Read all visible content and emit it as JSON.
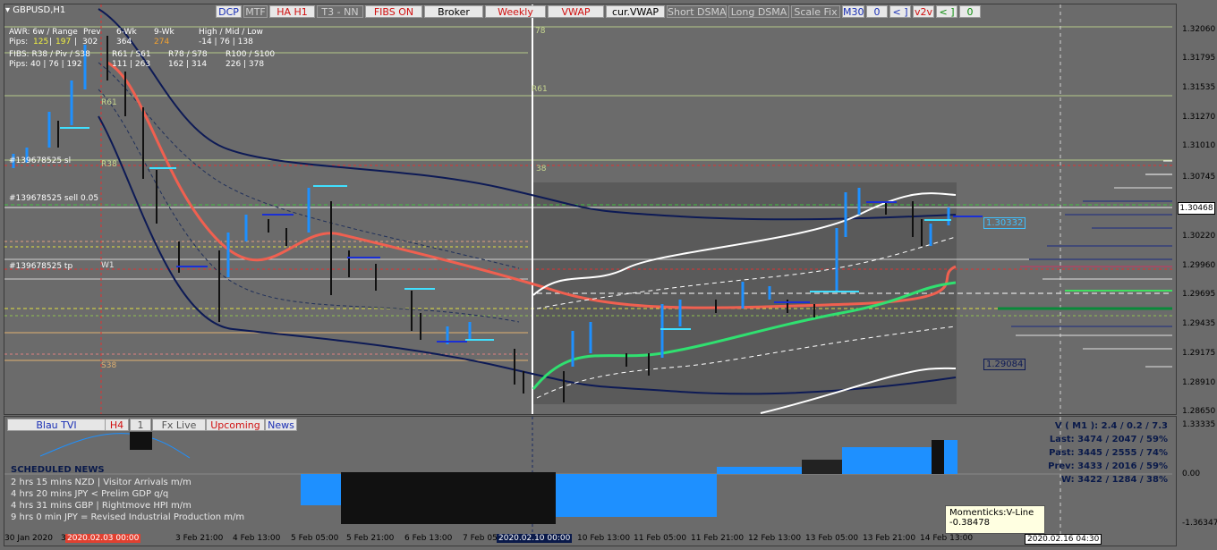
{
  "symbol_title": "GBPUSD,H1",
  "toolbar": [
    {
      "label": "DCP",
      "color": "#1a2fb5",
      "bg": "light"
    },
    {
      "label": "MTF",
      "color": "#d0d0d0",
      "bg": "dark"
    },
    {
      "label": "HA H1",
      "color": "#d01010",
      "bg": "light"
    },
    {
      "label": "T3 - NN",
      "color": "#d0d0d0",
      "bg": "dark"
    },
    {
      "label": "FIBS ON",
      "color": "#d01010",
      "bg": "light"
    },
    {
      "label": "Broker",
      "color": "#000000",
      "bg": "light"
    },
    {
      "label": "Weekly",
      "color": "#d01010",
      "bg": "light"
    },
    {
      "label": "VWAP",
      "color": "#d01010",
      "bg": "light"
    },
    {
      "label": "cur.VWAP",
      "color": "#000000",
      "bg": "light"
    },
    {
      "label": "Short DSMA",
      "color": "#d0d0d0",
      "bg": "dark"
    },
    {
      "label": "Long DSMA",
      "color": "#d0d0d0",
      "bg": "dark"
    },
    {
      "label": "Scale Fix",
      "color": "#d0d0d0",
      "bg": "dark"
    },
    {
      "label": "M30",
      "color": "#1a2fb5",
      "bg": "light"
    },
    {
      "label": "0",
      "color": "#1a2fb5",
      "bg": "light"
    },
    {
      "label": "< ]",
      "color": "#1a2fb5",
      "bg": "light"
    },
    {
      "label": "v2v",
      "color": "#d01010",
      "bg": "light"
    },
    {
      "label": "< ]",
      "color": "#0a8a0a",
      "bg": "light"
    },
    {
      "label": "0",
      "color": "#0a8a0a",
      "bg": "light"
    }
  ],
  "info_panel": {
    "awr_label": "AWR: 6w / Range",
    "awr_prev": "Prev",
    "pips_label": "Pips:",
    "awr_vals": [
      "125",
      "197",
      "302"
    ],
    "col_6wk": "6-Wk",
    "col_9wk": "9-Wk",
    "col_hml": "High / Mid / Low",
    "val_6wk": "364",
    "val_9wk": "274",
    "val_hml": "-14  |  76  |  138",
    "fibs_label": "FIBS: R38 / Piv / S38",
    "fibs_cols": "R61 / S61",
    "fibs_cols2": "R78 / S78",
    "fibs_cols3": "R100 / S100",
    "fibs_pips": "40  |  76  |  192",
    "fibs_v1": "111  |  263",
    "fibs_v2": "162  |  314",
    "fibs_v3": "226  |  378"
  },
  "level_labels": {
    "r78": "78",
    "r61_a": "R61",
    "r61_b": "R61",
    "r38": "R38",
    "r38_b": "38",
    "w1": "W1",
    "s38": "S38",
    "sl": "#139678525 sl",
    "sell": "#139678525 sell 0.05",
    "tp": "#139678525 tp"
  },
  "price_axis": [
    "1.32060",
    "1.31795",
    "1.31535",
    "1.31270",
    "1.31010",
    "1.30745",
    "1.30468",
    "1.30220",
    "1.29960",
    "1.29695",
    "1.29435",
    "1.29175",
    "1.28910",
    "1.28650"
  ],
  "price_tags": {
    "current": "1.30332",
    "lower": "1.29084",
    "axis_current": "1.30468"
  },
  "date_axis": [
    "30 Jan 2020",
    "3",
    "3 Feb 21:00",
    "4 Feb 13:00",
    "5 Feb 05:00",
    "5 Feb 21:00",
    "6 Feb 13:00",
    "7 Feb 05",
    "10 Feb 13:00",
    "11 Feb 05:00",
    "11 Feb 21:00",
    "12 Feb 13:00",
    "13 Feb 05:00",
    "13 Feb 21:00",
    "14 Feb 13:00"
  ],
  "date_tags": {
    "left": "2020.02.03 00:00",
    "mid": "2020.02.10 00:00",
    "right": "2020.02.16 04:30"
  },
  "sub_buttons": [
    {
      "label": "Blau TVI",
      "color": "#1a2fb5"
    },
    {
      "label": "H4",
      "color": "#d01010"
    },
    {
      "label": "1",
      "color": "#555555"
    },
    {
      "label": "Fx Live",
      "color": "#555555"
    },
    {
      "label": "Upcoming",
      "color": "#d01010"
    },
    {
      "label": "News",
      "color": "#1a2fb5"
    }
  ],
  "sub_axis": [
    "1.33335",
    "0.00",
    "-1.36347"
  ],
  "news": {
    "title": "SCHEDULED NEWS",
    "items": [
      "2 hrs 15 mins  NZD  |  Visitor Arrivals m/m",
      "4 hrs 20 mins  JPY  <  Prelim GDP q/q",
      "4 hrs 31 mins  GBP  |  Rightmove HPI m/m",
      "9 hrs 0 min  JPY  =  Revised Industrial Production m/m"
    ]
  },
  "stats": [
    "V ( M1 ): 2.4 / 0.2 / 7.3",
    "Last: 3474 / 2047 / 59%",
    "Past: 3445 / 2555 / 74%",
    "Prev: 3433 / 2016 / 59%",
    "W: 3422 / 1284 / 38%"
  ],
  "tooltip": {
    "title": "Momenticks:V-Line",
    "value": "-0.38478"
  }
}
